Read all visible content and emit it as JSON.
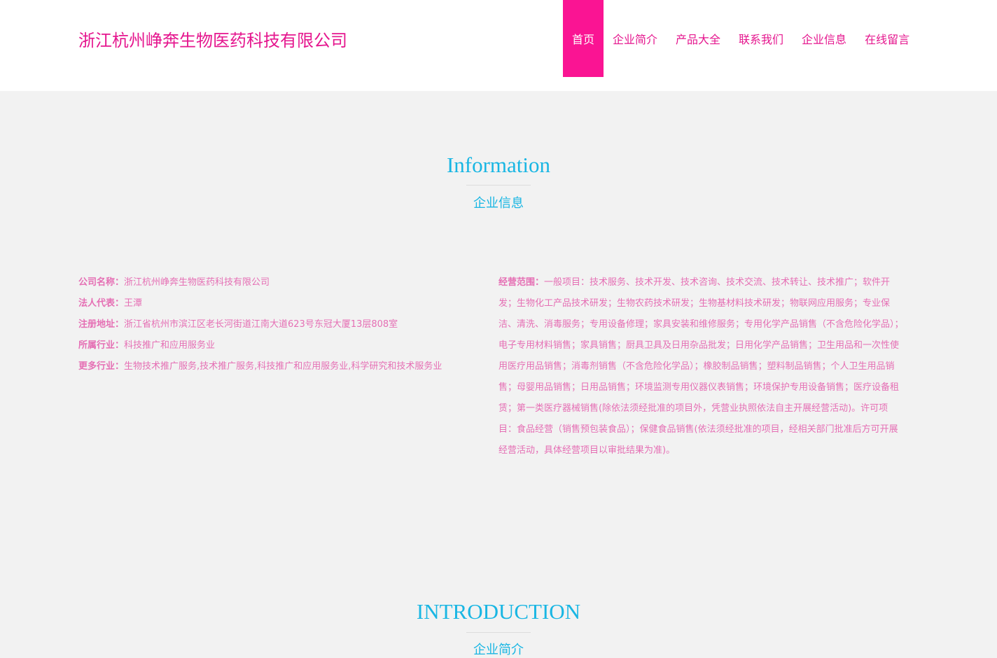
{
  "header": {
    "brand": "浙江杭州峥奔生物医药科技有限公司",
    "nav": [
      {
        "label": "首页",
        "active": true
      },
      {
        "label": "企业简介"
      },
      {
        "label": "产品大全"
      },
      {
        "label": "联系我们"
      },
      {
        "label": "企业信息"
      },
      {
        "label": "在线留言"
      }
    ]
  },
  "info": {
    "title": "Information",
    "subtitle": "企业信息",
    "company_label": "公司名称：",
    "company": "浙江杭州峥奔生物医药科技有限公司",
    "legal_label": "法人代表：",
    "legal": "王潭",
    "address_label": "注册地址：",
    "address": "浙江省杭州市滨江区老长河街道江南大道623号东冠大厦13层808室",
    "industry_label": "所属行业：",
    "industry": "科技推广和应用服务业",
    "more_label": "更多行业：",
    "more": "生物技术推广服务,技术推广服务,科技推广和应用服务业,科学研究和技术服务业",
    "scope_label": "经营范围：",
    "scope": "一般项目：技术服务、技术开发、技术咨询、技术交流、技术转让、技术推广；软件开发；生物化工产品技术研发；生物农药技术研发；生物基材料技术研发；物联网应用服务；专业保洁、清洗、消毒服务；专用设备修理；家具安装和维修服务；专用化学产品销售（不含危险化学品）；电子专用材料销售；家具销售；厨具卫具及日用杂品批发；日用化学产品销售；卫生用品和一次性使用医疗用品销售；消毒剂销售（不含危险化学品）；橡胶制品销售；塑料制品销售；个人卫生用品销售；母婴用品销售；日用品销售；环境监测专用仪器仪表销售；环境保护专用设备销售；医疗设备租赁；第一类医疗器械销售(除依法须经批准的项目外，凭营业执照依法自主开展经营活动)。许可项目：食品经营（销售预包装食品）；保健食品销售(依法须经批准的项目，经相关部门批准后方可开展经营活动，具体经营项目以审批结果为准)。"
  },
  "intro": {
    "title": "INTRODUCTION",
    "subtitle": "企业简介"
  }
}
